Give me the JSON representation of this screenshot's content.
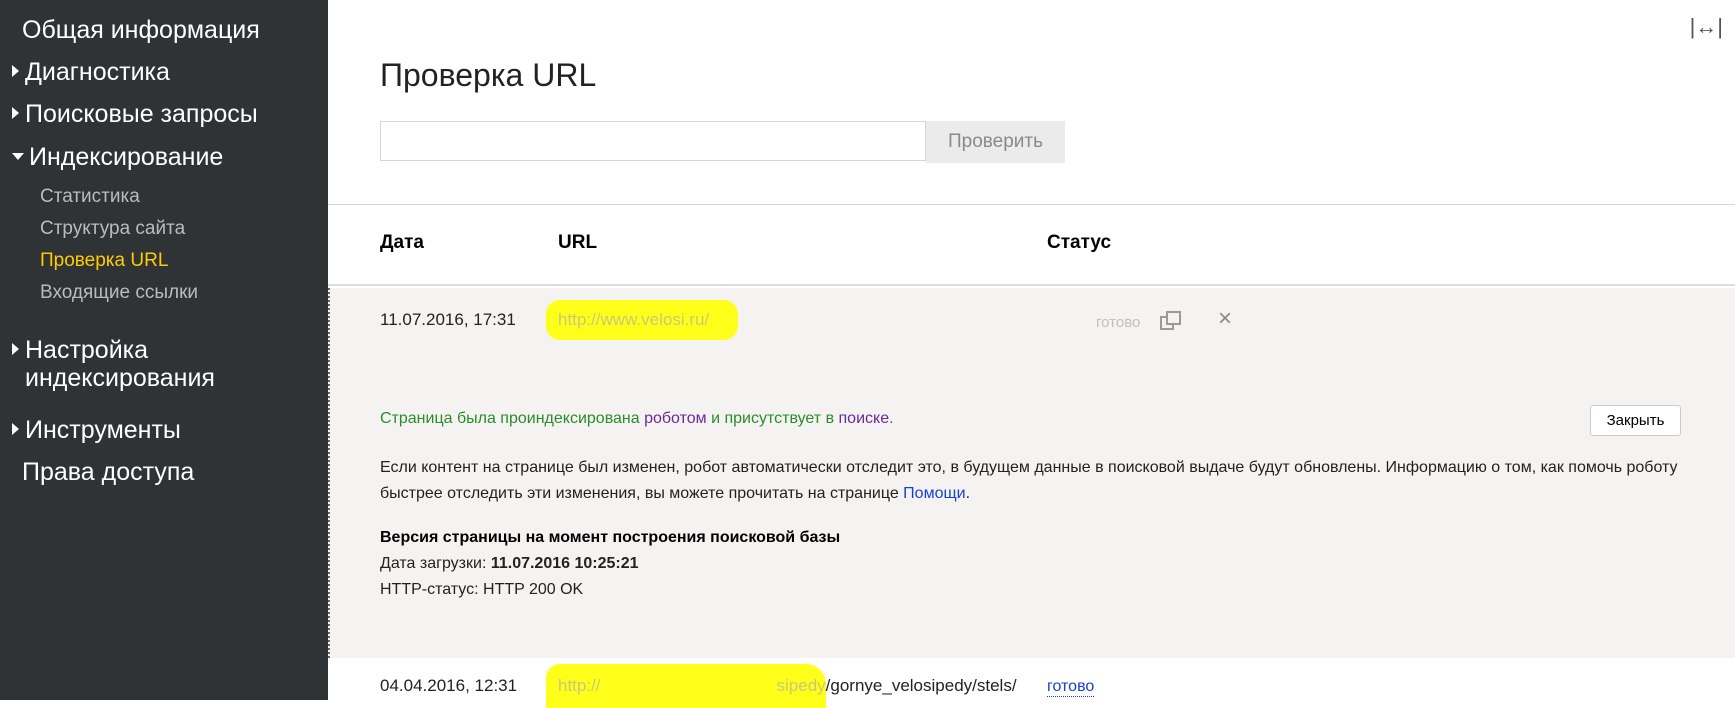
{
  "sidebar": {
    "general": "Общая информация",
    "diagnostics": "Диагностика",
    "search_queries": "Поисковые запросы",
    "indexing": "Индексирование",
    "indexing_sub": [
      "Статистика",
      "Структура сайта",
      "Проверка URL",
      "Входящие ссылки"
    ],
    "indexing_settings_line1": "Настройка",
    "indexing_settings_line2": "индексирования",
    "tools": "Инструменты",
    "access_rights": "Права доступа"
  },
  "page": {
    "title": "Проверка URL",
    "expand_icon": "↔",
    "url_input_value": "",
    "check_button": "Проверить"
  },
  "table": {
    "headers": {
      "date": "Дата",
      "url": "URL",
      "status": "Статус"
    },
    "rows": [
      {
        "date": "11.07.2016, 17:31",
        "url": "http://www.velosi.ru/",
        "status": "готово"
      },
      {
        "date": "04.04.2016, 12:31",
        "url_visible_start": "http://",
        "url_partial": "sipedy",
        "url_tail": "/gornye_velosipedy/stels/",
        "status": "готово"
      }
    ]
  },
  "details": {
    "indexed_part1": "Страница была проиндексирована ",
    "indexed_robot": "роботом",
    "indexed_part2": " и присутствует в ",
    "indexed_search": "поиске",
    "indexed_end": ".",
    "close_button": "Закрыть",
    "info_text": "Если контент на странице был изменен, робот автоматически отследит это, в будущем данные в поисковой выдаче будут обновлены. Информацию о том, как помочь роботу быстрее отследить эти изменения, вы можете прочитать на странице ",
    "info_link": "Помощи",
    "info_end": ".",
    "version_title": "Версия страницы на момент построения поисковой базы",
    "load_date_label": "Дата загрузки: ",
    "load_date_value": "11.07.2016 10:25:21",
    "http_status": "HTTP-статус: HTTP 200 OK"
  },
  "colors": {
    "sidebar_bg": "#2f3336",
    "active": "#ffcc00",
    "highlight": "#ffff1a",
    "link": "#1a3fd0",
    "green_text": "#2b8c2b"
  }
}
